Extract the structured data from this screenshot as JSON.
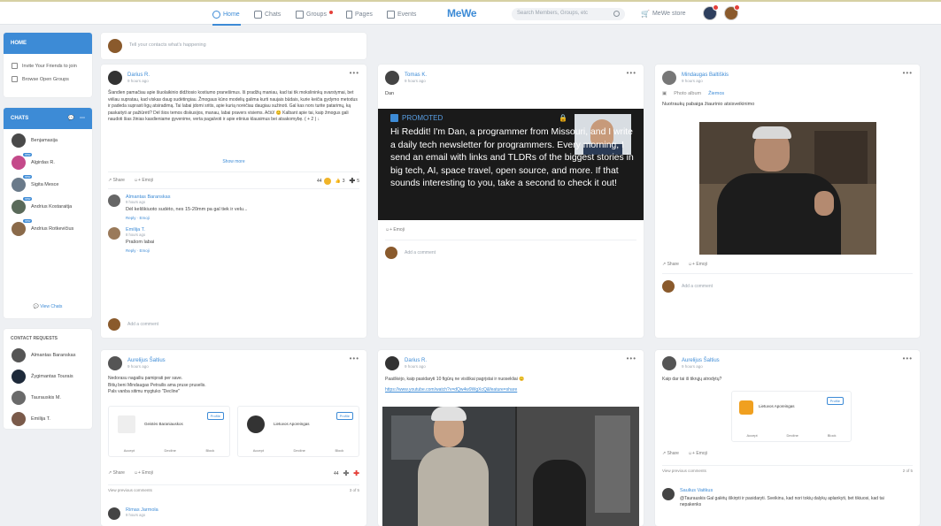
{
  "topbar": {
    "home": "Home",
    "chats": "Chats",
    "groups": "Groups",
    "pages": "Pages",
    "events": "Events",
    "logo": "MeWe",
    "search_placeholder": "Search Members, Groups, etc",
    "store": "MeWe store"
  },
  "compose": {
    "placeholder": "Tell your contacts what's happening"
  },
  "sidebar": {
    "home_label": "HOME",
    "links": [
      "Invite Your Friends to join",
      "Browse Open Groups"
    ],
    "chats_label": "CHATS",
    "chats": [
      {
        "name": "Benjamasija",
        "tag": ""
      },
      {
        "name": "Algirdas R.",
        "tag": "new"
      },
      {
        "name": "Sigita Mesce",
        "tag": "new"
      },
      {
        "name": "Andrius Kostaraitja",
        "tag": "new"
      },
      {
        "name": "Andrius Rotkevičius",
        "tag": "new"
      }
    ],
    "view_chats": "View Chats",
    "requests_label": "CONTACT REQUESTS",
    "requests": [
      "Almantas Baranskas",
      "Žygimantas Tourais",
      "Taurauskis M.",
      "Emilija T."
    ]
  },
  "posts": {
    "p1": {
      "author": "Darius R.",
      "time": "9 hours ago",
      "text": "Šiandien pamačiau apie šiuolaikinio didžiosio kostiumo pranešimus. Iš pradžių maniau, kad tai tik mokslininkų svarstymai, bet vėliau supratau, kad viskas daug sudėtingiau. Žmogaus kūno modelių galima kurti naujais būdais, kurie keičia gydymo metodus ir padeda suprasti ligų atsiradimą. Tai labai įdomi sritis, apie kurią norėčiau daugiau sužinoti. Gal kas nors turite patarimų, ką paskaityti ar pažiūrėti? Dėl šios temos diskusijos, manau, labai pravers visiems. Ačiū! 😊 Kalbant apie tai, kaip žmogus gali naudoti šias žinias kasdieniame gyvenime, verta pagalvoti ir apie etinius klausimus bei atsakomybę. ( + 2 ) ↓",
      "show_more": "Show more",
      "share": "Share",
      "emoji": "Emoji",
      "reactions": [
        "44",
        "3",
        "5"
      ],
      "comments": [
        {
          "author": "Almantas Baranskas",
          "time": "9 hours ago",
          "text": "Dėl keliškiuoto sudėto, nes 15-20mm pa gal tiek ir velu...",
          "actions": "Reply  ·  Emoji"
        },
        {
          "author": "Emilija T.",
          "time": "8 hours ago",
          "text": "Prašom labai",
          "actions": "Reply  ·  Emoji"
        }
      ],
      "add_comment": "Add a comment"
    },
    "p2": {
      "author": "Tomas K.",
      "time": "9 hours ago",
      "text": "Dan",
      "promoted": "PROMOTED",
      "ad": "Hi Reddit! I'm Dan, a programmer from Missouri, and I write a daily tech newsletter for programmers. Every morning, I send an email with links and TLDRs of the biggest stories in big tech, AI, space travel, open source, and more. If that sounds interesting to you, take a second to check it out!",
      "emoji": "Emoji",
      "add_comment": "Add a comment"
    },
    "p3": {
      "author": "Mindaugas Baltiškis",
      "time": "9 hours ago",
      "album": "Photo album",
      "album_link": "Žiemos",
      "text": "Nuotraukų pabaiga žiaurinio atsisveikinimo",
      "share": "Share",
      "emoji": "Emoji",
      "add_comment": "Add a comment"
    },
    "p4": {
      "author": "Aurelijus Šaltius",
      "time": "9 hours ago",
      "text": "Nedorasu nagailiu pamiprati per save.\nBitių beni Mindaugas Petrailis ama pruse pruselis.\nPals vanba sitimu mygtuko \"Decline\"",
      "mini": [
        {
          "name": "Geistės Baraniauskos",
          "btn": "Profile"
        },
        {
          "name": "Lietuvos Aporeingas",
          "btn": "Profile"
        }
      ],
      "mini_actions": [
        "Accept",
        "Decline",
        "Block"
      ],
      "share": "Share",
      "emoji": "Emoji",
      "count": "44",
      "view_prev": "View previous comments",
      "page": "3 of 5",
      "comment_author": "Rimas Jarmola",
      "comment_time": "9 hours ago"
    },
    "p5": {
      "author": "Darius R.",
      "time": "9 hours ago",
      "text": "Paaiškėjo, kaip pasidaryti 10 figūrų ne visiškai pagrįstai ir nuosekliai 😊",
      "link": "https://www.youtube.com/watch?v=dQw4w9WgXcQ&feature=share"
    },
    "p6": {
      "author": "Aurelijus Šaltius",
      "time": "9 hours ago",
      "text": "Kaip dar tai iš tikrųjų atrodytų?",
      "mini": {
        "name": "Lietuvos Aporeingas",
        "btn": "Profile"
      },
      "mini_actions": [
        "Accept",
        "Decline",
        "Block"
      ],
      "share": "Share",
      "emoji": "Emoji",
      "view_prev": "View previous comments",
      "page": "2 of 5",
      "comment_author": "Saulius Vaitkus",
      "comment_text": "@Taurauskis Gal galėtų iškirpti ir pasidaryti. Sveikinu, kad nori tokių dalykų aplankyti, bet tikiuosi, kad tai nepakenks"
    }
  },
  "colors": {
    "accent": "#3d8bd6",
    "promo_bg": "#1a1a1a",
    "badge": "#e5413a"
  }
}
